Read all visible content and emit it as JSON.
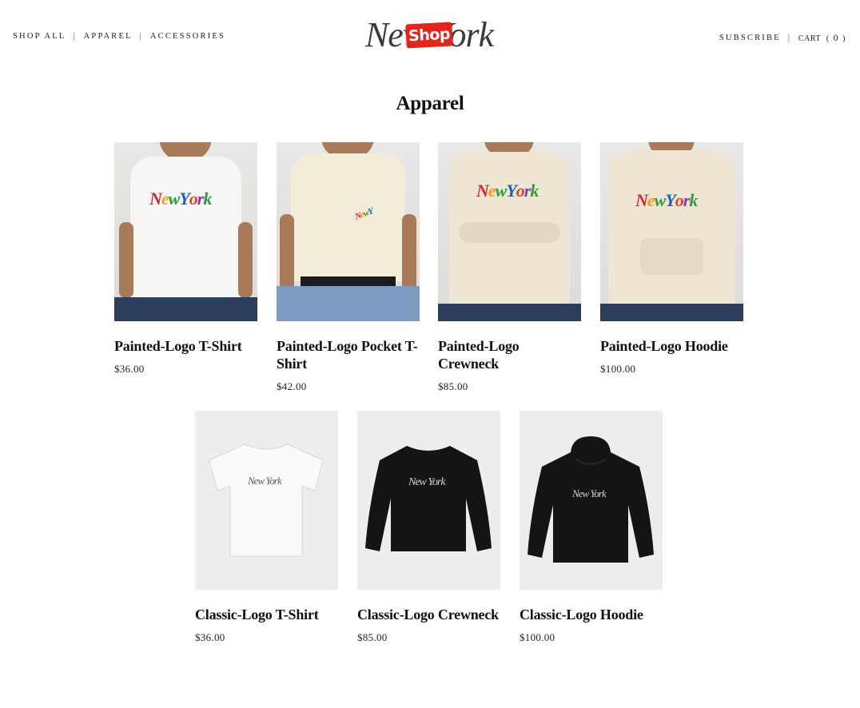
{
  "nav": {
    "left": [
      "SHOP ALL",
      "APPAREL",
      "ACCESSORIES"
    ],
    "separator": "|",
    "subscribe": "SUBSCRIBE",
    "cart_label": "CART",
    "cart_open": "(",
    "cart_count": "0",
    "cart_close": ")"
  },
  "logo": {
    "wordmark": "New York",
    "badge": "Shop"
  },
  "page": {
    "title": "Apparel"
  },
  "products": [
    {
      "name": "Painted-Logo T-Shirt",
      "price": "$36.00"
    },
    {
      "name": "Painted-Logo Pocket T-Shirt",
      "price": "$42.00"
    },
    {
      "name": "Painted-Logo Crewneck",
      "price": "$85.00"
    },
    {
      "name": "Painted-Logo Hoodie",
      "price": "$100.00"
    },
    {
      "name": "Classic-Logo T-Shirt",
      "price": "$36.00"
    },
    {
      "name": "Classic-Logo Crewneck",
      "price": "$85.00"
    },
    {
      "name": "Classic-Logo Hoodie",
      "price": "$100.00"
    }
  ],
  "graphic": {
    "painted_logo": "New York",
    "classic_logo": "New York"
  },
  "colors": {
    "brand_red": "#e2261c",
    "garment_white": "#f6f6f4",
    "garment_cream": "#ece4cf",
    "garment_black": "#111111",
    "denim": "#2c3d5c"
  }
}
